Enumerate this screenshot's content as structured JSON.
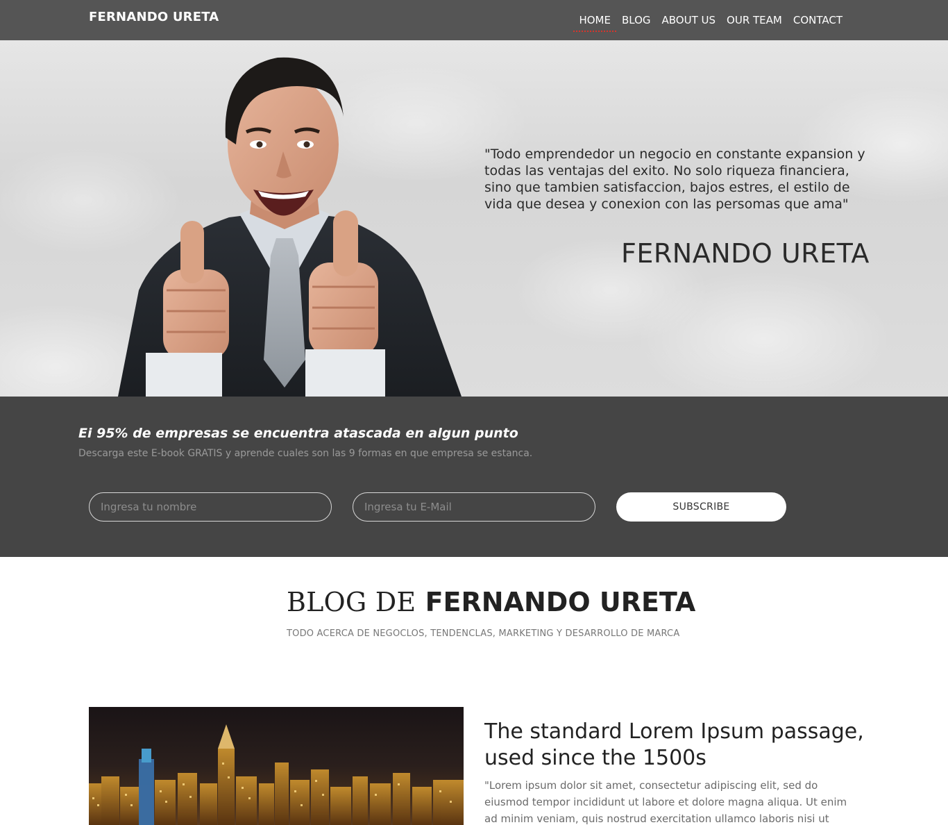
{
  "nav": {
    "brand": "FERNANDO URETA",
    "items": [
      {
        "label": "HOME",
        "active": true
      },
      {
        "label": "BLOG",
        "active": false
      },
      {
        "label": "ABOUT US",
        "active": false
      },
      {
        "label": "OUR TEAM",
        "active": false
      },
      {
        "label": "CONTACT",
        "active": false
      }
    ]
  },
  "hero": {
    "quote": "\"Todo emprendedor un negocio en constante expansion y todas las ventajas del exito. No solo riqueza financiera, sino que tambien satisfaccion, bajos estres, el estilo de vida que desea y conexion con las persomas que ama\"",
    "name": "FERNANDO URETA"
  },
  "subscribe": {
    "title": "Ei 95% de empresas se encuentra atascada en algun punto",
    "subtitle": "Descarga este E-book GRATIS y aprende cuales son las 9 formas en que empresa se estanca.",
    "name_placeholder": "Ingresa tu nombre",
    "email_placeholder": "Ingresa tu E-Mail",
    "button_label": "SUBSCRIBE"
  },
  "blog": {
    "title_part1": "BLOG DE",
    "title_part2": "FERNANDO URETA",
    "subtitle": "TODO ACERCA DE NEGOCLOS, TENDENCLAS, MARKETING Y DESARROLLO DE MARCA"
  },
  "post": {
    "title": "The standard Lorem Ipsum passage, used since the 1500s",
    "excerpt": "\"Lorem ipsum dolor sit amet, consectetur adipiscing elit, sed do eiusmod tempor incididunt ut labore et dolore magna aliqua. Ut enim ad minim veniam, quis nostrud exercitation ullamco laboris nisi ut aliquip ex ea"
  },
  "colors": {
    "navbar_bg": "#555555",
    "band_bg": "#454545",
    "active_underline": "#d9342b"
  }
}
